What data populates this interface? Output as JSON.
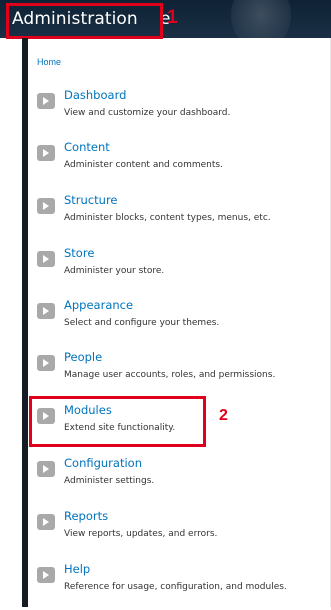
{
  "header": {
    "title": "Administration",
    "cut_char": "e"
  },
  "annotations": {
    "one": "1",
    "two": "2"
  },
  "breadcrumb": "Home",
  "menu": [
    {
      "title": "Dashboard",
      "desc": "View and customize your dashboard."
    },
    {
      "title": "Content",
      "desc": "Administer content and comments."
    },
    {
      "title": "Structure",
      "desc": "Administer blocks, content types, menus, etc."
    },
    {
      "title": "Store",
      "desc": "Administer your store."
    },
    {
      "title": "Appearance",
      "desc": "Select and configure your themes."
    },
    {
      "title": "People",
      "desc": "Manage user accounts, roles, and permissions."
    },
    {
      "title": "Modules",
      "desc": "Extend site functionality."
    },
    {
      "title": "Configuration",
      "desc": "Administer settings."
    },
    {
      "title": "Reports",
      "desc": "View reports, updates, and errors."
    },
    {
      "title": "Help",
      "desc": "Reference for usage, configuration, and modules."
    }
  ],
  "colors": {
    "link": "#0074bd",
    "annotation": "#e0001b",
    "header_bg": "#1a2f44"
  }
}
